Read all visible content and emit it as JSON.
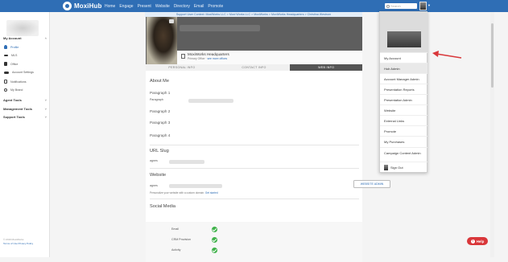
{
  "app": {
    "name": "MoxiHub"
  },
  "nav": {
    "items": [
      "Home",
      "Engage",
      "Present",
      "Website",
      "Directory",
      "Email",
      "Promote"
    ]
  },
  "search": {
    "placeholder": "Search"
  },
  "support_banner": "Support User Context: MoxiWorks LLC > Moxi Works LLC > MoxiWorks > MoxiWorks Headquarters > Christina Westrom",
  "sidebar": {
    "my_account": "My Account",
    "items": [
      {
        "label": "Profile",
        "icon": "user-icon",
        "active": true
      },
      {
        "label": "MLS",
        "icon": "mls-icon"
      },
      {
        "label": "Office",
        "icon": "office-icon"
      },
      {
        "label": "Account Settings",
        "icon": "gear-icon"
      },
      {
        "label": "Notifications",
        "icon": "bell-icon"
      },
      {
        "label": "My Brand",
        "icon": "brand-icon"
      }
    ],
    "agent_tools": "Agent Tools",
    "management_tools": "Management Tools",
    "support_tools": "Support Tools",
    "footer_copy": "© 2019 MoxiWorks",
    "footer_link": "Terms of Use  Privacy Policy"
  },
  "office": {
    "name": "MoxiWorks Headquarters",
    "role": "Primary Office · ",
    "change_link": "see more offices"
  },
  "tabs": [
    "PERSONAL INFO",
    "CONTACT INFO",
    "WEB INFO"
  ],
  "web_info": {
    "about_heading": "About Me",
    "paragraph_1": "Paragraph 1",
    "paragraph_label": "Paragraph",
    "paragraph_2": "Paragraph 2",
    "paragraph_3": "Paragraph 3",
    "paragraph_4": "Paragraph 4",
    "url_heading": "URL Slug",
    "url_label": "agnes",
    "website_heading": "Website",
    "website_label": "agnes",
    "website_admin_button": "WEBSITE ADMIN",
    "personalize_text": "Personalize your website with a custom domain. ",
    "personalize_link": "Get started",
    "social_heading": "Social Media",
    "social_rows": [
      "Email",
      "CRM Provision",
      "Activity"
    ]
  },
  "dropdown": {
    "items": [
      "My Account",
      "Hub Admin",
      "Account Manager Admin",
      "Presentation Reports",
      "Presentation Admin",
      "Website",
      "External Links",
      "Promote",
      "My Purchases",
      "Campaign Content Admin",
      "Sign Out"
    ],
    "highlighted": "Hub Admin"
  },
  "help": {
    "label": "Help"
  },
  "colors": {
    "brand": "#2f6eb5",
    "arrow": "#d9373a",
    "success": "#3fb24a"
  }
}
